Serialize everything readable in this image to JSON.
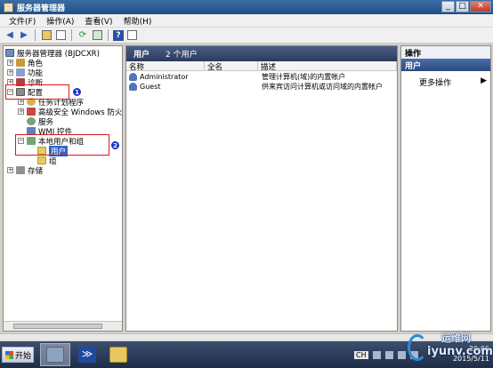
{
  "window": {
    "title": "服务器管理器"
  },
  "window_buttons": {
    "minimize": "_",
    "maximize": "□",
    "close": "✕"
  },
  "menu": [
    "文件(F)",
    "操作(A)",
    "查看(V)",
    "帮助(H)"
  ],
  "toolbar": {
    "help_label": "?"
  },
  "tree": {
    "root": "服务器管理器 (BJDCXR)",
    "roles": "角色",
    "features": "功能",
    "diagnostics": "诊断",
    "configuration": "配置",
    "task_scheduler": "任务计划程序",
    "firewall": "高级安全 Windows 防火墙",
    "services": "服务",
    "wmi": "WMI 控件",
    "local_users_groups": "本地用户和组",
    "users": "用户",
    "groups": "组",
    "storage": "存储",
    "expand_plus": "+",
    "expand_minus": "−"
  },
  "annotations": {
    "badge1": "1",
    "badge2": "2"
  },
  "center": {
    "header_title": "用户",
    "header_count": "2 个用户",
    "columns": [
      "名称",
      "全名",
      "描述"
    ],
    "rows": [
      {
        "name": "Administrator",
        "fullname": "",
        "description": "管理计算机(域)的内置帐户"
      },
      {
        "name": "Guest",
        "fullname": "",
        "description": "供来宾访问计算机或访问域的内置帐户"
      }
    ]
  },
  "actions": {
    "title": "操作",
    "section": "用户",
    "more": "更多操作",
    "more_arrow": "▶"
  },
  "taskbar": {
    "start_label": "开始",
    "ps_glyph": "≫",
    "lang": "CH",
    "clock_time": "20:06",
    "clock_date": "2015/5/11"
  },
  "watermark": {
    "top": "运维网",
    "bottom": "iyunv.com"
  }
}
